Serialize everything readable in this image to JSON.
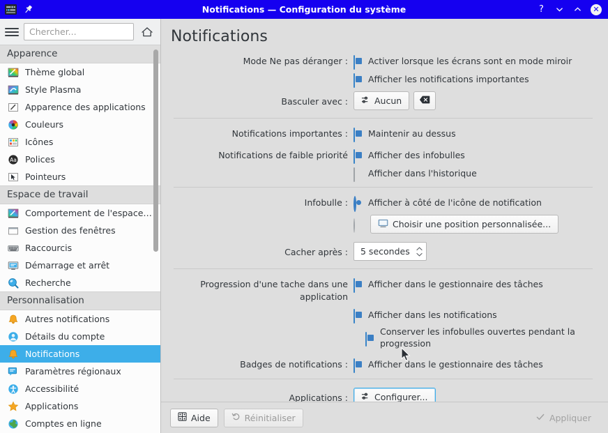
{
  "window": {
    "title": "Notifications — Configuration du système",
    "left_icons": [
      {
        "name": "system-settings-icon",
        "label": "Configuration du système"
      },
      {
        "name": "pin-icon",
        "label": "Épingler"
      }
    ],
    "controls": {
      "help": "?",
      "minimize": "chevron-down-icon",
      "maximize": "chevron-up-icon",
      "close": "✕"
    }
  },
  "sidebar": {
    "search": {
      "placeholder": "Chercher...",
      "value": ""
    },
    "hamburger_label": "Menu",
    "home_label": "Accueil",
    "groups": [
      {
        "header": "Apparence",
        "items": [
          {
            "label": "Thème global",
            "icon": "global-theme-icon"
          },
          {
            "label": "Style Plasma",
            "icon": "plasma-style-icon"
          },
          {
            "label": "Apparence des applications",
            "icon": "application-style-icon"
          },
          {
            "label": "Couleurs",
            "icon": "colors-icon"
          },
          {
            "label": "Icônes",
            "icon": "icons-icon"
          },
          {
            "label": "Polices",
            "icon": "fonts-icon"
          },
          {
            "label": "Pointeurs",
            "icon": "cursors-icon"
          }
        ]
      },
      {
        "header": "Espace de travail",
        "items": [
          {
            "label": "Comportement de l'espace de tr...",
            "icon": "workspace-behavior-icon"
          },
          {
            "label": "Gestion des fenêtres",
            "icon": "window-management-icon"
          },
          {
            "label": "Raccourcis",
            "icon": "shortcuts-icon"
          },
          {
            "label": "Démarrage et arrêt",
            "icon": "startup-shutdown-icon"
          },
          {
            "label": "Recherche",
            "icon": "search-module-icon"
          }
        ]
      },
      {
        "header": "Personnalisation",
        "items": [
          {
            "label": "Autres notifications",
            "icon": "bell-icon"
          },
          {
            "label": "Détails du compte",
            "icon": "account-icon"
          },
          {
            "label": "Notifications",
            "icon": "bell-icon",
            "selected": true
          },
          {
            "label": "Paramètres régionaux",
            "icon": "regional-settings-icon"
          },
          {
            "label": "Accessibilité",
            "icon": "accessibility-icon"
          },
          {
            "label": "Applications",
            "icon": "applications-star-icon"
          },
          {
            "label": "Comptes en ligne",
            "icon": "online-accounts-icon"
          }
        ]
      }
    ]
  },
  "main": {
    "page_title": "Notifications",
    "sections": {
      "dnd": {
        "label": "Mode Ne pas déranger :",
        "check_mirror": {
          "text": "Activer lorsque les écrans sont en mode miroir",
          "checked": true
        },
        "check_critical": {
          "text": "Afficher les notifications importantes",
          "checked": true
        },
        "toggle_label": "Basculer avec :",
        "toggle_button": "Aucun",
        "clear_button_label": "Effacer le raccourci"
      },
      "critical": {
        "label": "Notifications importantes :",
        "check_keep_on_top": {
          "text": "Maintenir au dessus",
          "checked": true
        }
      },
      "lowpriority": {
        "label": "Notifications de faible priorité",
        "check_popup": {
          "text": "Afficher des infobulles",
          "checked": true
        },
        "check_history": {
          "text": "Afficher dans l'historique",
          "checked": false
        }
      },
      "popup": {
        "label": "Infobulle :",
        "radio_near_icon": {
          "text": "Afficher à côté de l'icône de notification",
          "checked": true
        },
        "radio_custom": {
          "checked": false
        },
        "custom_button": "Choisir une position personnalisée...",
        "hide_label": "Cacher après :",
        "hide_value": "5 secondes"
      },
      "jobs": {
        "label": "Progression d'une tache dans une application",
        "check_taskmanager": {
          "text": "Afficher dans le gestionnaire des tâches",
          "checked": true
        },
        "check_notifications": {
          "text": "Afficher dans les notifications",
          "checked": true
        },
        "check_keep_popups": {
          "text": "Conserver les infobulles ouvertes pendant la progression",
          "checked": true
        }
      },
      "badges": {
        "label": "Badges de notifications :",
        "check_taskmanager": {
          "text": "Afficher dans le gestionnaire des tâches",
          "checked": true
        }
      },
      "applications": {
        "label": "Applications :",
        "configure_button": "Configurer..."
      }
    }
  },
  "footer": {
    "help": "Aide",
    "reset": "Réinitialiser",
    "apply": "Appliquer"
  },
  "colors": {
    "titlebar": "#1500f0",
    "accent": "#3daee9",
    "checkbox": "#3b7fc4",
    "window_bg": "#dedede",
    "sidebar_bg": "#fcfcfc"
  }
}
